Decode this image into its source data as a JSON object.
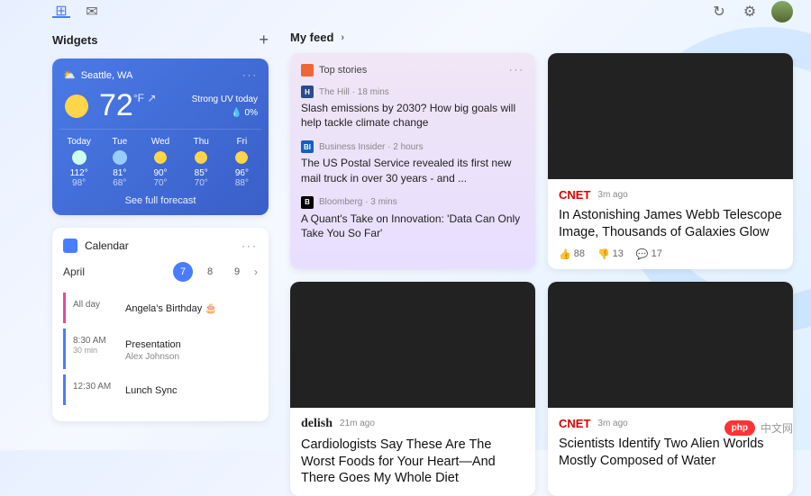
{
  "topbar": {
    "home": "⊞",
    "mail": "✉",
    "settings": "⚙"
  },
  "widgets": {
    "title": "Widgets",
    "add": "+",
    "weather": {
      "location": "Seattle, WA",
      "temp": "72",
      "deg": "°F",
      "arrow": "↗",
      "uv": "Strong UV today",
      "precip": "💧 0%",
      "days": [
        {
          "name": "Today",
          "icon": "cloud",
          "hi": "112°",
          "lo": "98°"
        },
        {
          "name": "Tue",
          "icon": "rain",
          "hi": "81°",
          "lo": "68°"
        },
        {
          "name": "Wed",
          "icon": "sun",
          "hi": "90°",
          "lo": "70°"
        },
        {
          "name": "Thu",
          "icon": "sun",
          "hi": "85°",
          "lo": "70°"
        },
        {
          "name": "Fri",
          "icon": "sun",
          "hi": "96°",
          "lo": "88°"
        }
      ],
      "link": "See full forecast"
    },
    "calendar": {
      "title": "Calendar",
      "month": "April",
      "days": [
        {
          "n": "7",
          "sel": true
        },
        {
          "n": "8"
        },
        {
          "n": "9"
        }
      ],
      "chev": "›",
      "events": [
        {
          "color": "pink",
          "time": "All day",
          "dur": "",
          "title": "Angela's Birthday 🎂",
          "sub": ""
        },
        {
          "color": "blue",
          "time": "8:30 AM",
          "dur": "30 min",
          "title": "Presentation",
          "sub": "Alex Johnson"
        },
        {
          "color": "blue",
          "time": "12:30 AM",
          "dur": "",
          "title": "Lunch Sync",
          "sub": ""
        }
      ]
    }
  },
  "feed": {
    "title": "My feed",
    "chev": "›",
    "top_stories": {
      "label": "Top stories",
      "dots": "···",
      "items": [
        {
          "badge": "H",
          "badge_bg": "#2a4b8d",
          "source": "The Hill",
          "time": "18 mins",
          "title": "Slash emissions by 2030? How big goals will help tackle climate change"
        },
        {
          "badge": "BI",
          "badge_bg": "#1560bd",
          "source": "Business Insider",
          "time": "2 hours",
          "title": "The US Postal Service revealed its first new mail truck in over 30 years - and ..."
        },
        {
          "badge": "B",
          "badge_bg": "#000",
          "source": "Bloomberg",
          "time": "3 mins",
          "title": "A Quant's Take on Innovation: 'Data Can Only Take You So Far'"
        }
      ]
    },
    "cards": [
      {
        "img": "stars",
        "brand": "CNET",
        "brand_cls": "cnet",
        "time": "3m ago",
        "headline": "In Astonishing James Webb Telescope Image, Thousands of Galaxies Glow",
        "reacts": {
          "like": "88",
          "dislike": "13",
          "comment": "17"
        }
      },
      {
        "img": "smoothie",
        "brand": "delish",
        "brand_cls": "delish",
        "time": "21m ago",
        "headline": "Cardiologists Say These Are The Worst Foods for Your Heart—And There Goes My Whole Diet"
      },
      {
        "img": "planets",
        "brand": "CNET",
        "brand_cls": "cnet",
        "time": "3m ago",
        "headline": "Scientists Identify Two Alien Worlds Mostly Composed of Water"
      }
    ]
  },
  "watermark": {
    "badge": "php",
    "text": "中文网"
  }
}
